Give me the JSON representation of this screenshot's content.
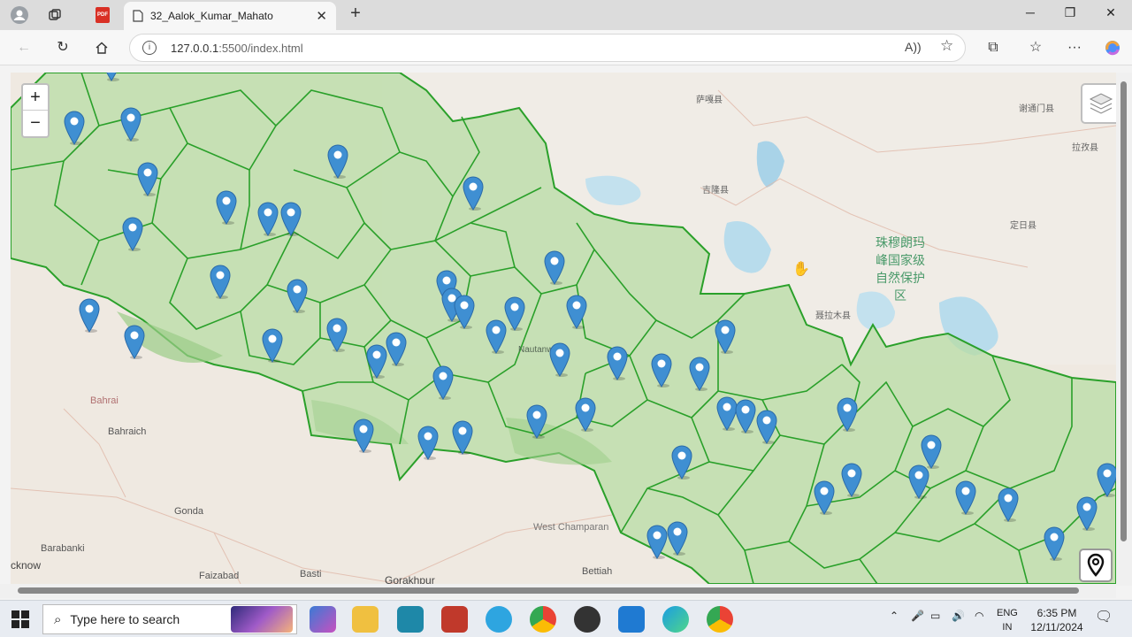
{
  "browser": {
    "tab_title": "32_Aalok_Kumar_Mahato",
    "url_host": "127.0.0.1",
    "url_rest": ":5500/index.html",
    "pdf_badge": "PDF"
  },
  "map": {
    "zoom_in_label": "+",
    "zoom_out_label": "−",
    "labels": {
      "bahraich": "Bahraich",
      "bahrai_hn": "Bahrai",
      "gonda": "Gonda",
      "barabanki": "Barabanki",
      "lucknow": "cknow",
      "faizabad": "Faizabad",
      "basti": "Basti",
      "gorakhpur": "Gorakhpur",
      "west_champaran": "West Champaran",
      "bettiah": "Bettiah",
      "nautanwa": "Nautanwa"
    },
    "cn_reserve": "珠穆朗玛\n峰国家级\n自然保护\n区",
    "cn_labels": [
      "萨嘎县",
      "吉隆县",
      "聂拉木县",
      "定日县",
      "拉孜县",
      "谢通门县"
    ]
  },
  "taskbar": {
    "search_placeholder": "Type here to search",
    "lang_top": "ENG",
    "lang_bottom": "IN",
    "time": "6:35 PM",
    "date": "12/11/2024"
  }
}
